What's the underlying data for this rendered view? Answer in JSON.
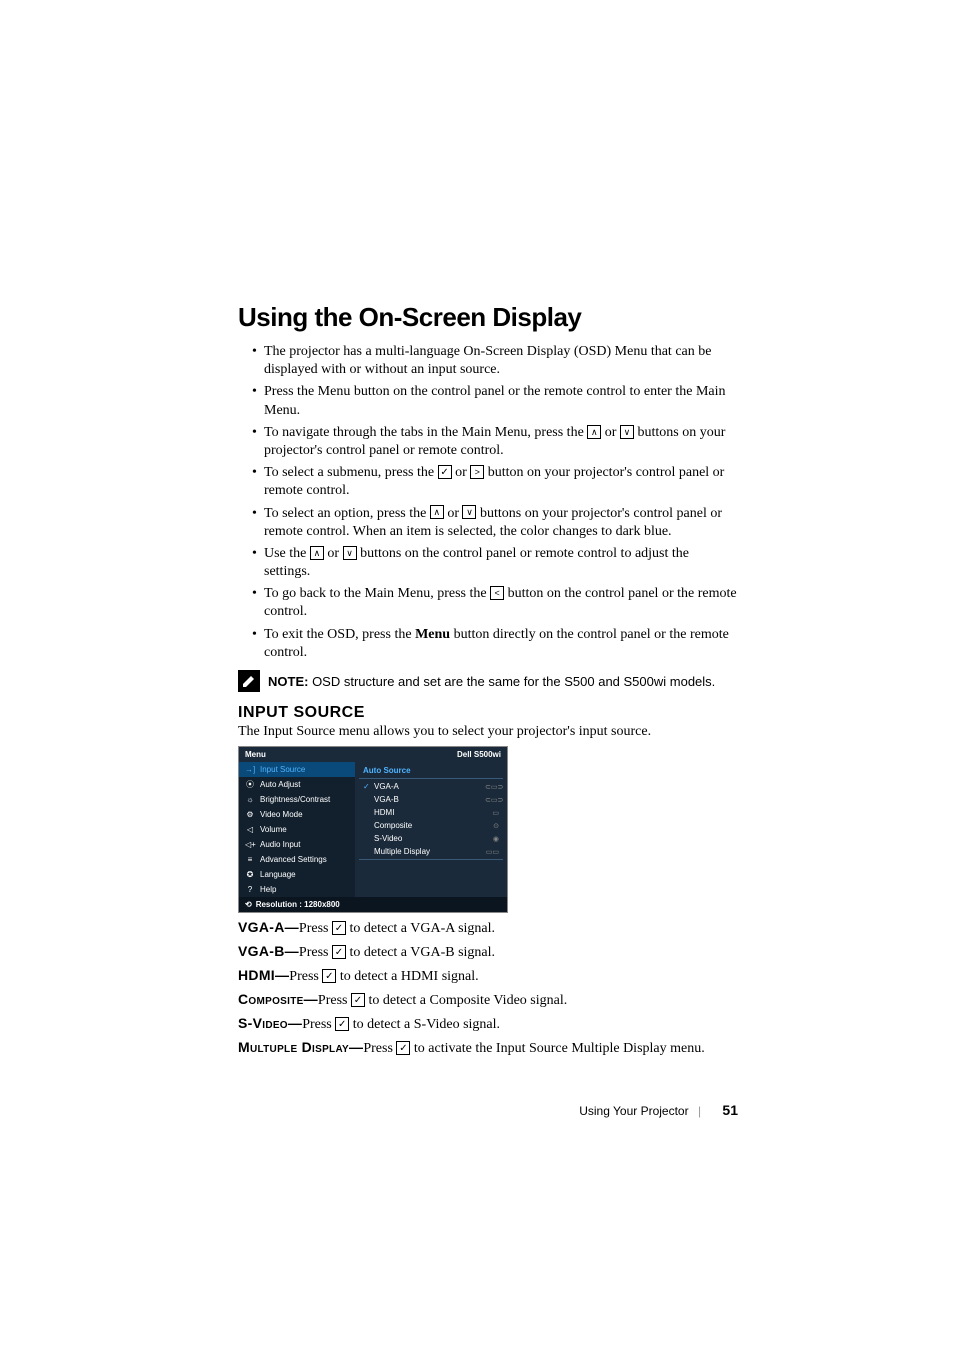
{
  "title": "Using the On-Screen Display",
  "bullets": {
    "b1a": "The projector has a multi-language On-Screen Display (OSD) Menu that can be displayed with or without an input source.",
    "b2a": "Press the Menu button on the control panel or the remote control to enter the Main Menu.",
    "b3a": "To navigate through the tabs in the Main Menu, press the ",
    "b3b": " or ",
    "b3c": " buttons on your projector's control panel or remote control.",
    "b4a": "To select a submenu, press the ",
    "b4b": " or ",
    "b4c": " button on your projector's control panel or remote control.",
    "b5a": "To select an option, press the ",
    "b5b": " or ",
    "b5c": " buttons on your projector's control panel or remote control. When an item is selected, the color changes to dark blue.",
    "b6a": "Use the ",
    "b6b": " or ",
    "b6c": " buttons on the control panel or remote control to adjust the settings.",
    "b7a": "To go back to the Main Menu, press the ",
    "b7b": " button on the control panel or the remote control.",
    "b8a": "To exit the OSD, press the ",
    "b8b": "Menu",
    "b8c": " button directly on the control panel or the remote control."
  },
  "note": {
    "label": "NOTE:",
    "text": " OSD structure and set are the same for the S500 and S500wi models."
  },
  "section": {
    "heading": "INPUT SOURCE",
    "intro": "The Input Source menu allows you to select your projector's input source."
  },
  "osd": {
    "header_left": "Menu",
    "header_right": "Dell  S500wi",
    "left_items": [
      "Input Source",
      "Auto Adjust",
      "Brightness/Contrast",
      "Video Mode",
      "Volume",
      "Audio Input",
      "Advanced Settings",
      "Language",
      "Help"
    ],
    "left_icons": [
      "→]",
      "⦿",
      "☼",
      "⚙",
      "◁",
      "◁+",
      "≡",
      "✪",
      "?"
    ],
    "right_header": "Auto Source",
    "right_items": [
      "VGA-A",
      "VGA-B",
      "HDMI",
      "Composite",
      "S-Video",
      "Multiple Display"
    ],
    "right_check": [
      true,
      false,
      false,
      false,
      false,
      false
    ],
    "port_icons": [
      "⊂▭⊃",
      "⊂▭⊃",
      "▭",
      "⊙",
      "◉",
      "▭▭"
    ],
    "footer_icon": "⟲",
    "footer": "Resolution : 1280x800"
  },
  "descriptions": {
    "vga_a": {
      "label": "VGA-A—",
      "pre": "Press ",
      "post": " to detect a VGA-A signal."
    },
    "vga_b": {
      "label": "VGA-B—",
      "pre": "Press ",
      "post": " to detect a VGA-B signal."
    },
    "hdmi": {
      "label": "HDMI—",
      "pre": "Press ",
      "post": " to detect a HDMI signal."
    },
    "composite": {
      "label": "Composite—",
      "pre": "Press ",
      "post": " to detect a Composite Video signal."
    },
    "svideo": {
      "label": "S-Video—",
      "pre": "Press ",
      "post": " to detect a S-Video signal."
    },
    "multiple": {
      "label": "Multuple Display—",
      "pre": "Press ",
      "post": " to activate the Input Source Multiple Display menu."
    }
  },
  "footer": {
    "text": "Using Your Projector",
    "page": "51"
  }
}
